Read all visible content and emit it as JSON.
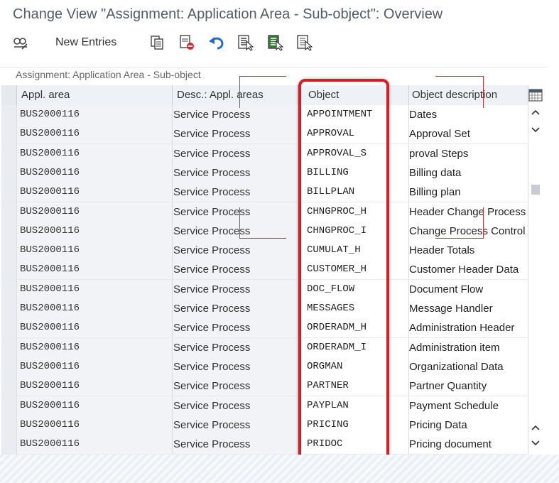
{
  "title": "Change View \"Assignment: Application Area - Sub-object\": Overview",
  "toolbar": {
    "new_entries_label": "New Entries",
    "icons": [
      "display-change-icon",
      "copy-icon",
      "delete-icon",
      "undo-icon",
      "select-all-icon",
      "select-block-icon",
      "deselect-all-icon"
    ]
  },
  "panel": {
    "title": "Assignment: Application Area - Sub-object"
  },
  "table": {
    "columns": [
      "Appl. area",
      "Desc.: Appl. areas",
      "Object",
      "Object description"
    ],
    "rows": [
      {
        "area": "BUS2000116",
        "desc": "Service Process",
        "object": "APPOINTMENT",
        "object_desc": "Dates"
      },
      {
        "area": "BUS2000116",
        "desc": "Service Process",
        "object": "APPROVAL",
        "object_desc": "Approval Set"
      },
      {
        "area": "BUS2000116",
        "desc": "Service Process",
        "object": "APPROVAL_S",
        "object_desc": "proval Steps"
      },
      {
        "area": "BUS2000116",
        "desc": "Service Process",
        "object": "BILLING",
        "object_desc": "Billing data"
      },
      {
        "area": "BUS2000116",
        "desc": "Service Process",
        "object": "BILLPLAN",
        "object_desc": "Billing plan"
      },
      {
        "area": "BUS2000116",
        "desc": "Service Process",
        "object": "CHNGPROC_H",
        "object_desc": "Header Change Process"
      },
      {
        "area": "BUS2000116",
        "desc": "Service Process",
        "object": "CHNGPROC_I",
        "object_desc": "Change Process Control"
      },
      {
        "area": "BUS2000116",
        "desc": "Service Process",
        "object": "CUMULAT_H",
        "object_desc": "Header Totals"
      },
      {
        "area": "BUS2000116",
        "desc": "Service Process",
        "object": "CUSTOMER_H",
        "object_desc": "Customer Header Data"
      },
      {
        "area": "BUS2000116",
        "desc": "Service Process",
        "object": "DOC_FLOW",
        "object_desc": "Document Flow"
      },
      {
        "area": "BUS2000116",
        "desc": "Service Process",
        "object": "MESSAGES",
        "object_desc": "Message Handler"
      },
      {
        "area": "BUS2000116",
        "desc": "Service Process",
        "object": "ORDERADM_H",
        "object_desc": "Administration Header"
      },
      {
        "area": "BUS2000116",
        "desc": "Service Process",
        "object": "ORDERADM_I",
        "object_desc": "Administration item"
      },
      {
        "area": "BUS2000116",
        "desc": "Service Process",
        "object": "ORGMAN",
        "object_desc": "Organizational Data"
      },
      {
        "area": "BUS2000116",
        "desc": "Service Process",
        "object": "PARTNER",
        "object_desc": "Partner Quantity"
      },
      {
        "area": "BUS2000116",
        "desc": "Service Process",
        "object": "PAYPLAN",
        "object_desc": "Payment Schedule"
      },
      {
        "area": "BUS2000116",
        "desc": "Service Process",
        "object": "PRICING",
        "object_desc": "Pricing Data"
      },
      {
        "area": "BUS2000116",
        "desc": "Service Process",
        "object": "PRIDOC",
        "object_desc": "Pricing document"
      }
    ]
  },
  "highlight_color": "#d41e24",
  "accent_color": "#1f6fc6"
}
